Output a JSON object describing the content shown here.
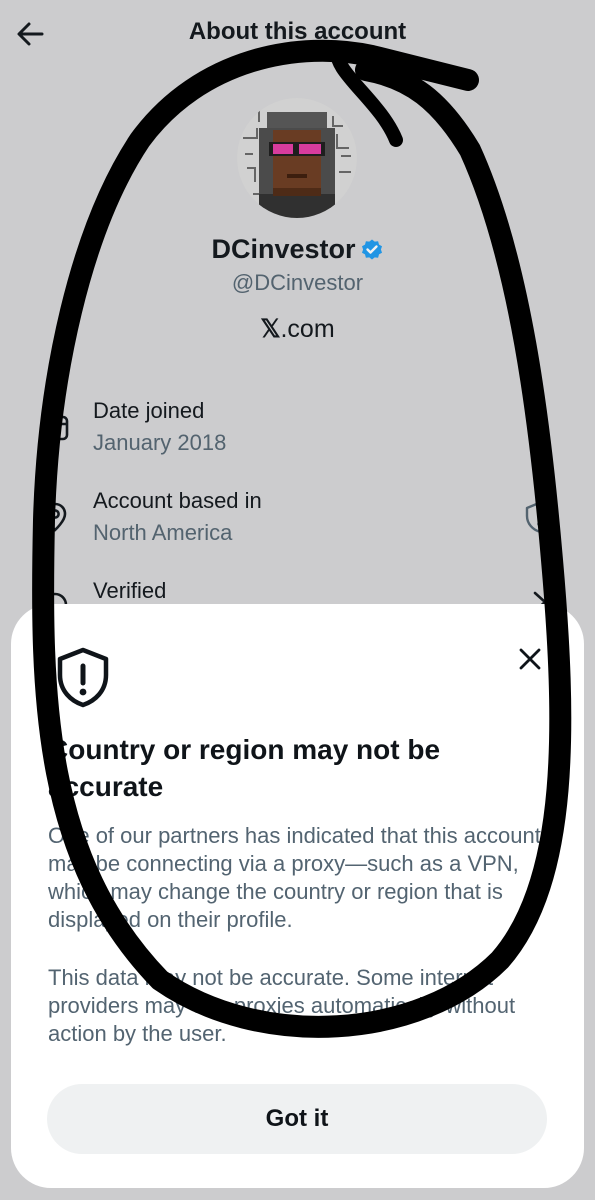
{
  "header": {
    "title": "About this account",
    "back_icon": "arrow-left-icon"
  },
  "profile": {
    "display_name": "DCinvestor",
    "handle": "@DCinvestor",
    "verified_badge_color": "#1d9bf0",
    "site_brand": "𝕏",
    "site_suffix": ".com"
  },
  "details": [
    {
      "label": "Date joined",
      "value": "January 2018",
      "icon": "calendar-icon"
    },
    {
      "label": "Account based in",
      "value": "North America",
      "icon": "location-pin-icon",
      "action_icon": "shield-alert-icon"
    },
    {
      "label": "Verified",
      "icon": "verified-seal-icon",
      "action_icon": "chevron-right-icon"
    }
  ],
  "sheet": {
    "title": "Country or region may not be accurate",
    "paragraph_1": "One of our partners has indicated that this account may be connecting via a proxy—such as a VPN, which may change the country or region that is displayed on their profile.",
    "paragraph_2": "This data may not be accurate. Some internet providers may use proxies automatically without action by the user.",
    "button_label": "Got it",
    "icon": "shield-alert-icon",
    "close_icon": "close-icon"
  },
  "colors": {
    "background": "#d6d6d8",
    "sheet": "#ffffff",
    "text_primary": "#0f1419",
    "text_secondary": "#536471",
    "button_bg": "#eff1f2",
    "scribble": "#000000"
  }
}
